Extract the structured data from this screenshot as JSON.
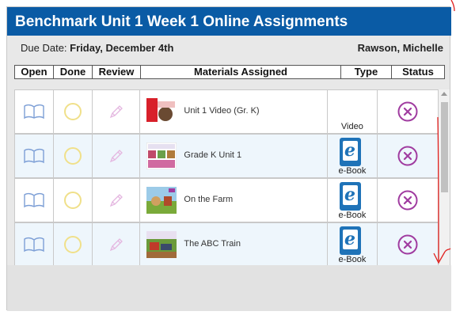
{
  "header": {
    "title": "Benchmark Unit 1 Week 1 Online Assignments"
  },
  "meta": {
    "due_label": "Due Date:",
    "due_value": "Friday, December 4th",
    "student": "Rawson, Michelle"
  },
  "columns": [
    "Open",
    "Done",
    "Review",
    "Materials Assigned",
    "Type",
    "Status"
  ],
  "rows": [
    {
      "title": "Unit 1 Video (Gr. K)",
      "type": "Video"
    },
    {
      "title": "Grade K Unit 1",
      "type": "e-Book"
    },
    {
      "title": "On the Farm",
      "type": "e-Book"
    },
    {
      "title": "The ABC Train",
      "type": "e-Book"
    }
  ],
  "icons": {
    "open": "open-book-icon",
    "done": "circle-icon",
    "review": "pencil-icon",
    "type_ebook": "ebook-icon",
    "status": "x-circle-icon"
  },
  "colors": {
    "brand": "#0a5ba5",
    "status": "#a03ca0",
    "done_circle": "#f0e08a",
    "annotation": "#e0201e"
  }
}
